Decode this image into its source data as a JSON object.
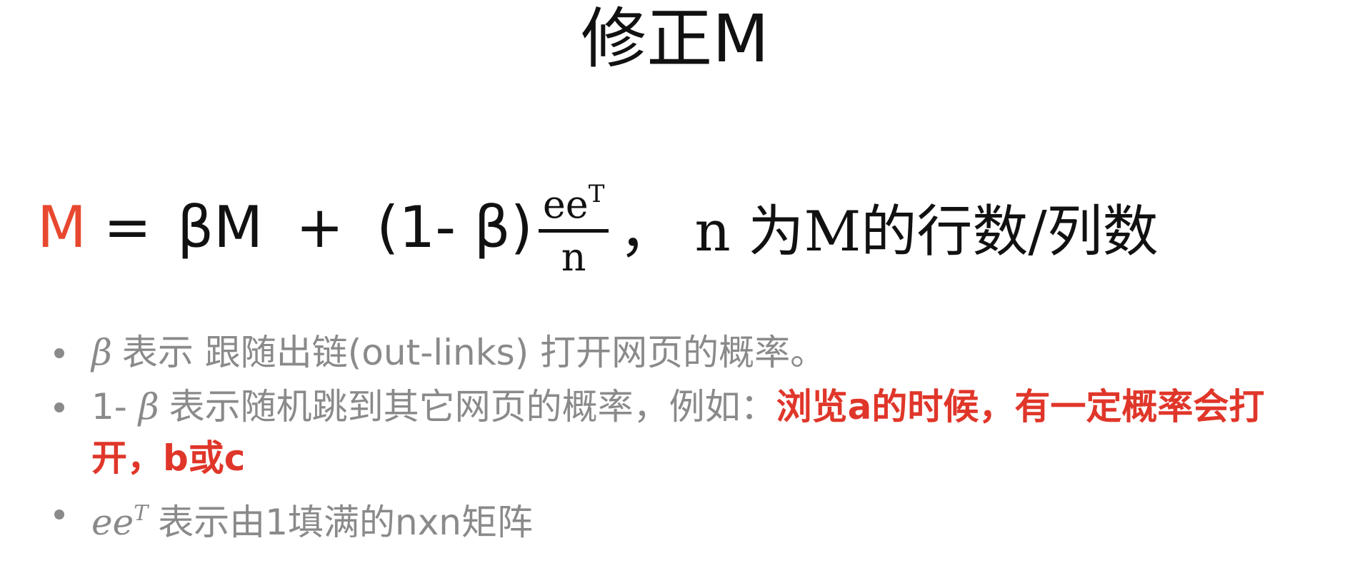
{
  "title": "修正M",
  "formula": {
    "lhs": "M",
    "equals": "=",
    "term1": "βM",
    "plus": "+",
    "term2": "(1- β)",
    "fraction_numerator": "ee",
    "fraction_numerator_sup": "T",
    "fraction_denominator": "n",
    "comma": "，",
    "note": "n 为M的行数/列数"
  },
  "bullets": [
    {
      "symbol": "β",
      "text": "表示 跟随出链(out-links) 打开网页的概率。",
      "highlight": ""
    },
    {
      "prefix": "1- ",
      "symbol": "β",
      "text": "表示随机跳到其它网页的概率，例如：",
      "highlight": "浏览a的时候，有一定概率会打开，b或c"
    },
    {
      "symbol": "ee",
      "symbol_sup": "T",
      "text": "表示由1填满的nxn矩阵",
      "highlight": ""
    }
  ],
  "colors": {
    "title": "#111111",
    "formula_lhs": "#e8482f",
    "bullet_text": "#8a8a8a",
    "highlight": "#e0362a"
  }
}
